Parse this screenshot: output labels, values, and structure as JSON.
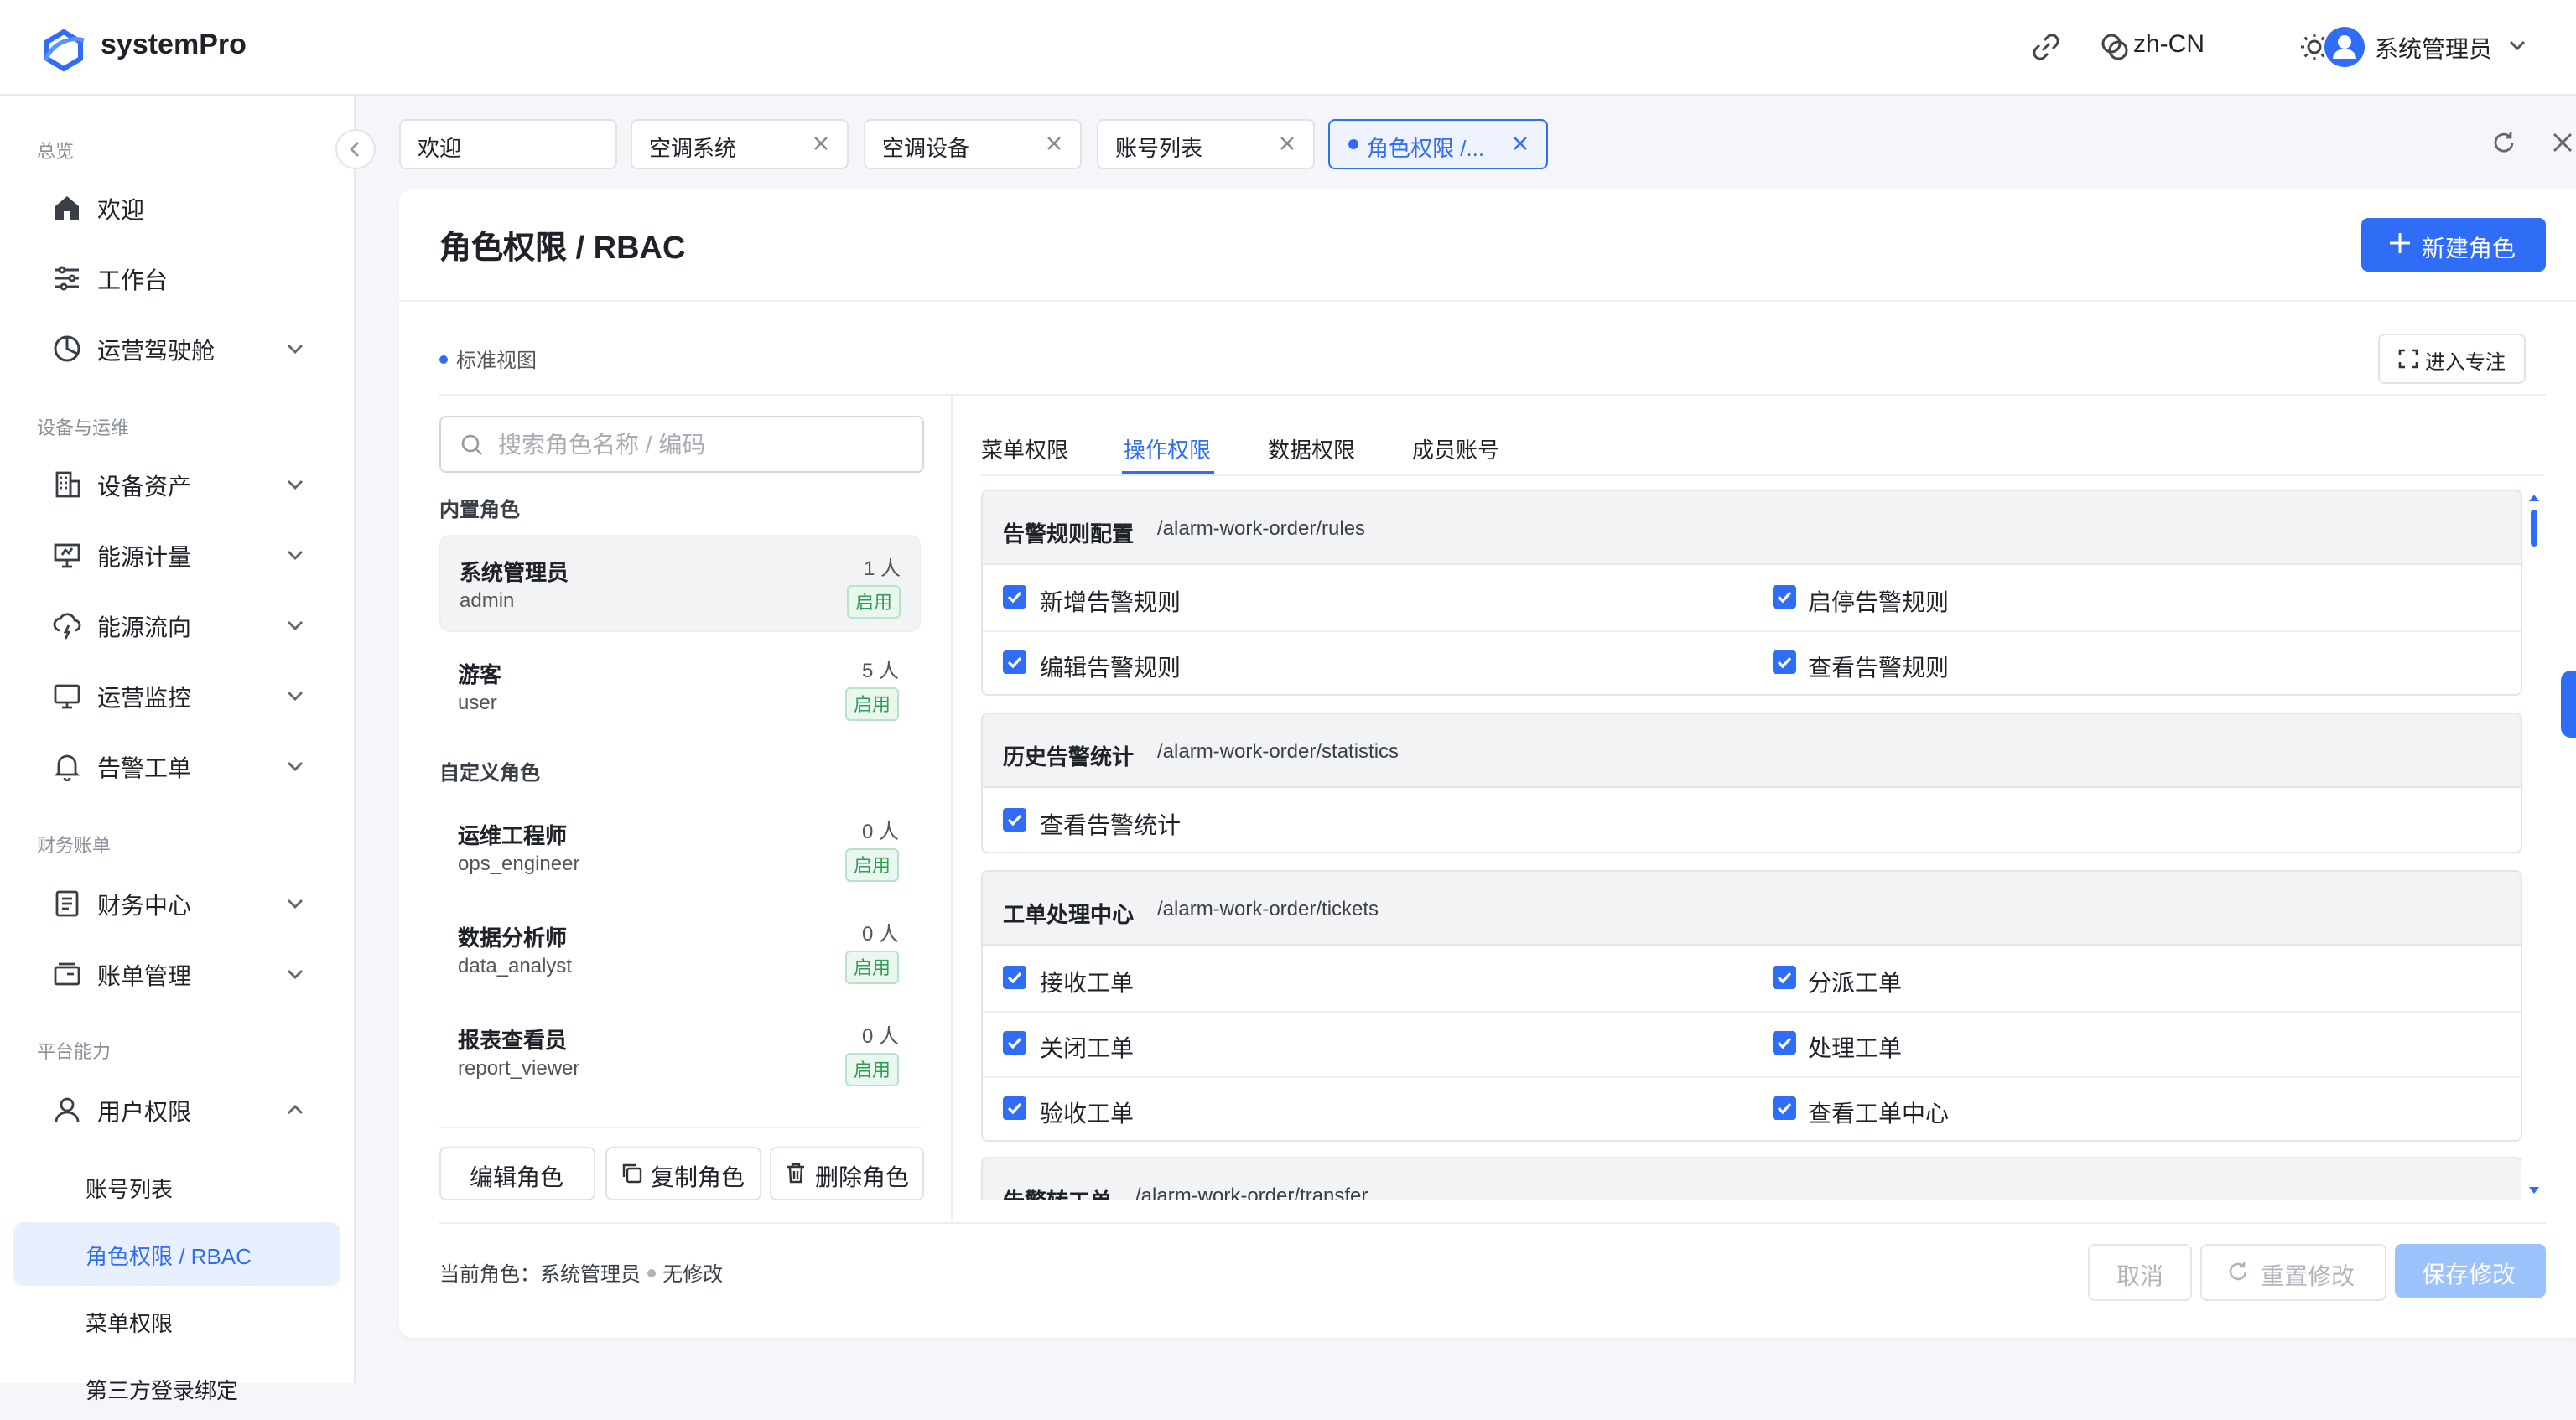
{
  "app": {
    "brand": "systemPro",
    "lang": "zh-CN",
    "user": "系统管理员"
  },
  "sidebar": {
    "groups": [
      "总览",
      "设备与运维",
      "财务账单",
      "平台能力"
    ],
    "items": [
      {
        "label": "欢迎",
        "icon": "home-icon"
      },
      {
        "label": "工作台",
        "icon": "sliders-icon"
      },
      {
        "label": "运营驾驶舱",
        "icon": "pie-chart-icon"
      },
      {
        "label": "设备资产",
        "icon": "building-icon"
      },
      {
        "label": "能源计量",
        "icon": "meter-icon"
      },
      {
        "label": "能源流向",
        "icon": "cloud-flow-icon"
      },
      {
        "label": "运营监控",
        "icon": "monitor-icon"
      },
      {
        "label": "告警工单",
        "icon": "bell-icon"
      },
      {
        "label": "财务中心",
        "icon": "document-icon"
      },
      {
        "label": "账单管理",
        "icon": "wallet-icon"
      },
      {
        "label": "用户权限",
        "icon": "user-icon"
      }
    ],
    "sub": [
      "账号列表",
      "角色权限 / RBAC",
      "菜单权限",
      "第三方登录绑定"
    ]
  },
  "tabs": [
    "欢迎",
    "空调系统",
    "空调设备",
    "账号列表",
    "角色权限 /..."
  ],
  "page": {
    "title": "角色权限 / RBAC",
    "new_button": "新建角色",
    "view_label": "标准视图",
    "focus_button": "进入专注"
  },
  "roles": {
    "search_placeholder": "搜索角色名称 / 编码",
    "builtin_label": "内置角色",
    "custom_label": "自定义角色",
    "builtin": [
      {
        "name": "系统管理员",
        "code": "admin",
        "count": "1 人",
        "status": "启用"
      },
      {
        "name": "游客",
        "code": "user",
        "count": "5 人",
        "status": "启用"
      }
    ],
    "custom": [
      {
        "name": "运维工程师",
        "code": "ops_engineer",
        "count": "0 人",
        "status": "启用"
      },
      {
        "name": "数据分析师",
        "code": "data_analyst",
        "count": "0 人",
        "status": "启用"
      },
      {
        "name": "报表查看员",
        "code": "report_viewer",
        "count": "0 人",
        "status": "启用"
      }
    ],
    "actions": {
      "edit": "编辑角色",
      "copy": "复制角色",
      "delete": "删除角色"
    }
  },
  "perm_tabs": [
    "菜单权限",
    "操作权限",
    "数据权限",
    "成员账号"
  ],
  "perm_groups": [
    {
      "title": "告警规则配置",
      "path": "/alarm-work-order/rules",
      "items": [
        "新增告警规则",
        "启停告警规则",
        "编辑告警规则",
        "查看告警规则"
      ]
    },
    {
      "title": "历史告警统计",
      "path": "/alarm-work-order/statistics",
      "items": [
        "查看告警统计"
      ]
    },
    {
      "title": "工单处理中心",
      "path": "/alarm-work-order/tickets",
      "items": [
        "接收工单",
        "分派工单",
        "关闭工单",
        "处理工单",
        "验收工单",
        "查看工单中心"
      ]
    },
    {
      "title": "告警转工单",
      "path": "/alarm-work-order/transfer",
      "items": []
    }
  ],
  "footer": {
    "current_label": "当前角色：",
    "current_role": "系统管理员",
    "state": "无修改",
    "cancel": "取消",
    "reset": "重置修改",
    "save": "保存修改"
  },
  "colors": {
    "primary": "#2f6df6",
    "success": "#2e9e56"
  }
}
